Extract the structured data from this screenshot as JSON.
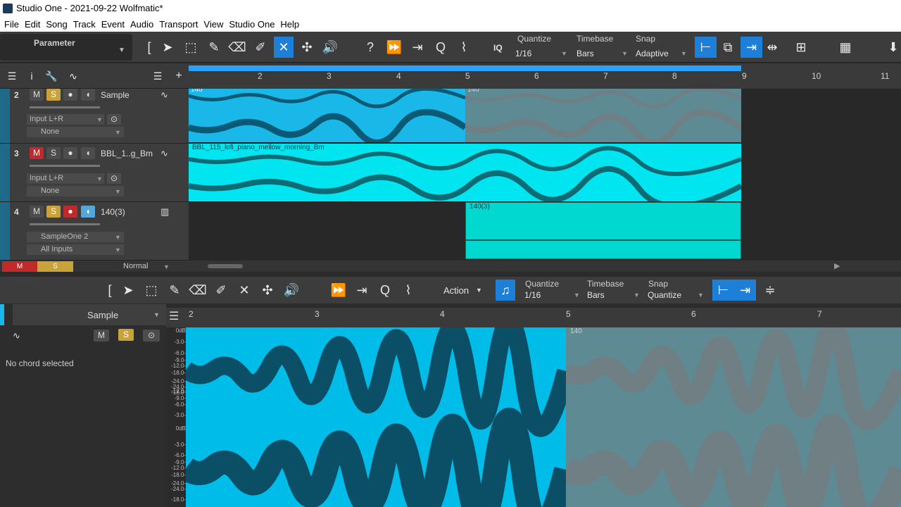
{
  "window": {
    "title": "Studio One - 2021-09-22 Wolfmatic*"
  },
  "menu": [
    "File",
    "Edit",
    "Song",
    "Track",
    "Event",
    "Audio",
    "Transport",
    "View",
    "Studio One",
    "Help"
  ],
  "toolbar": {
    "parameter_label": "Parameter",
    "quantize_label": "Quantize",
    "quantize_value": "1/16",
    "timebase_label": "Timebase",
    "timebase_value": "Bars",
    "snap_label": "Snap",
    "snap_value": "Adaptive",
    "iq_label": "IQ"
  },
  "ruler": {
    "bars": [
      "2",
      "3",
      "4",
      "5",
      "6",
      "7",
      "8",
      "9",
      "10",
      "11"
    ]
  },
  "tracks": [
    {
      "number": "2",
      "mute": "M",
      "solo": "S",
      "name": "Sample",
      "input": "Input L+R",
      "output": "None"
    },
    {
      "number": "3",
      "mute": "M",
      "solo": "S",
      "name": "BBL_1..g_Bm",
      "input": "Input L+R",
      "output": "None"
    },
    {
      "number": "4",
      "mute": "M",
      "solo": "S",
      "name": "140(3)",
      "input": "SampleOne 2",
      "output": "All Inputs"
    }
  ],
  "clips": {
    "track2_left": "140",
    "track2_right": "140",
    "track3": "BBL_115_lofi_piano_mellow_morning_Bm",
    "track4": "140(3)"
  },
  "status_row": {
    "mute_all": "M",
    "solo_all": "S",
    "mode": "Normal"
  },
  "editor": {
    "action_label": "Action",
    "quantize_label": "Quantize",
    "quantize_value": "1/16",
    "timebase_label": "Timebase",
    "timebase_value": "Bars",
    "snap_label": "Snap",
    "snap_value": "Quantize",
    "track_select": "Sample",
    "mute": "M",
    "solo": "S",
    "chord_status": "No chord selected",
    "ruler_bars": [
      "2",
      "3",
      "4",
      "5",
      "6",
      "7"
    ],
    "clip_label": "140",
    "db_scale": [
      "0dB",
      "-3.0-",
      "-6.0-",
      "-9.0-",
      "-12.0-",
      "-18.0-",
      "-24.0-",
      "-24.0-",
      "-18.0-",
      "-12.0-",
      "-9.0-",
      "-6.0-",
      "-3.0-",
      "0dB",
      "-3.0-",
      "-6.0-",
      "-9.0-",
      "-12.0-",
      "-18.0-",
      "-24.0-",
      "-24.0-",
      "-18.0-"
    ]
  },
  "colors": {
    "clip_blue": "#1ab8e8",
    "clip_cyan": "#00e5f0",
    "clip_teal": "#00d8d0",
    "clip_grey": "#5e8a94",
    "active_tool": "#1d7fd8",
    "mute_red": "#c02a2a",
    "solo_yellow": "#c9a33a"
  }
}
